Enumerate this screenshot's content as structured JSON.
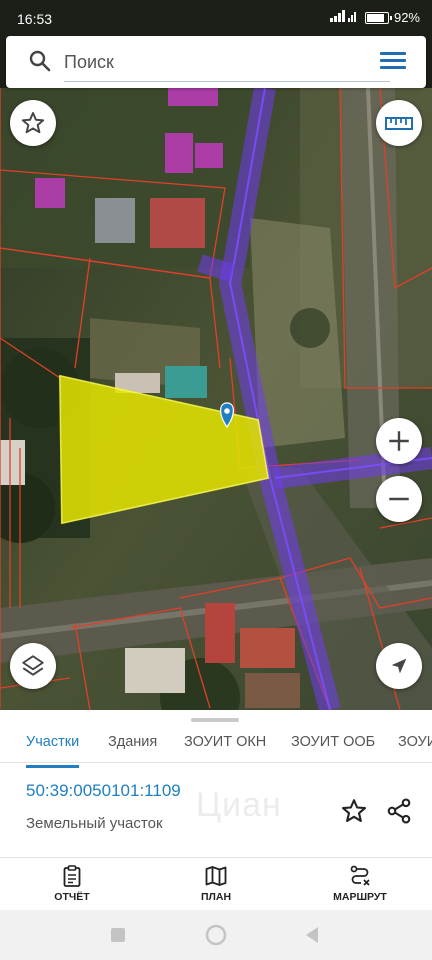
{
  "status_bar": {
    "time": "16:53",
    "battery": "92%"
  },
  "search": {
    "placeholder": "Поиск"
  },
  "map_controls": {
    "favorite": "star-icon",
    "measure": "ruler-icon",
    "zoom_in": "plus-icon",
    "zoom_out": "minus-icon",
    "layers": "layers-icon",
    "locate": "navigation-arrow-icon"
  },
  "tabs": [
    {
      "label": "Участки",
      "active": true
    },
    {
      "label": "Здания",
      "active": false
    },
    {
      "label": "ЗОУИТ ОКН",
      "active": false
    },
    {
      "label": "ЗОУИТ ООБ",
      "active": false
    },
    {
      "label": "ЗОУИ",
      "active": false
    }
  ],
  "parcel": {
    "cadastral_number": "50:39:0050101:1109",
    "type": "Земельный участок"
  },
  "watermark": "Циан",
  "actions": [
    {
      "label": "ОТЧЁТ",
      "icon": "clipboard-icon"
    },
    {
      "label": "ПЛАН",
      "icon": "map-icon"
    },
    {
      "label": "МАРШРУТ",
      "icon": "route-icon"
    }
  ],
  "colors": {
    "accent": "#1f7fc0",
    "parcel_fill": "#e6e600",
    "zone_line": "#6f3cf0",
    "boundary_line": "#e0402a",
    "building_fill": "#d13ad0"
  }
}
